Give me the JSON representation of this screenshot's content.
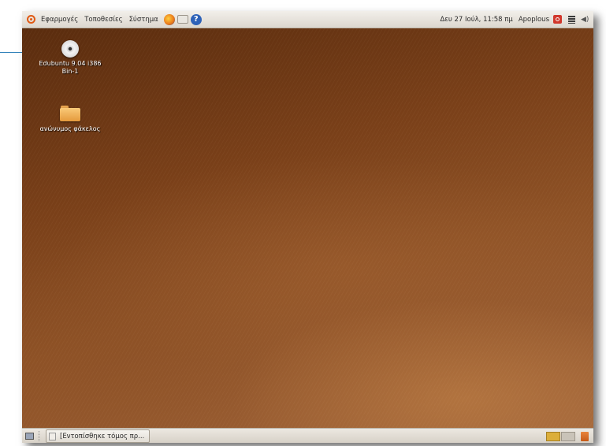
{
  "top_panel": {
    "menus": [
      "Εφαρμογές",
      "Τοποθεσίες",
      "Σύστημα"
    ],
    "launchers": [
      "firefox-icon",
      "mail-icon",
      "help-icon"
    ],
    "clock": "Δευ 27 Ιούλ, 11:58 πμ",
    "user": "Apoplous"
  },
  "desktop": {
    "icons": [
      {
        "label_line1": "Edubuntu 9.04 i386",
        "label_line2": "Bin-1",
        "icon": "cd-icon"
      },
      {
        "label_line1": "ανώνυμος φάκελος",
        "icon": "folder-icon"
      }
    ]
  },
  "bottom_panel": {
    "task": "[Εντοπίσθηκε τόμος πρ...",
    "workspaces": 2
  },
  "colors": {
    "callout": "#2d7fb8",
    "panel": "#e4e0d8",
    "desktop_dark": "#5a2c0e",
    "desktop_light": "#a0643a"
  }
}
